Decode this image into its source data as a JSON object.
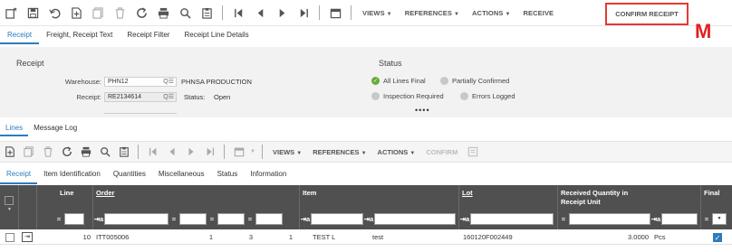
{
  "toolbar": {
    "views": "VIEWS",
    "references": "REFERENCES",
    "actions": "ACTIONS",
    "receive": "RECEIVE",
    "confirm_receipt": "CONFIRM RECEIPT",
    "icons": [
      "clear-icon",
      "save-icon",
      "undo-icon",
      "new-icon",
      "copy-icon",
      "delete-icon",
      "refresh-icon",
      "print-icon",
      "search-icon",
      "clipboard-icon",
      "first-icon",
      "prev-icon",
      "next-icon",
      "last-icon",
      "calendar-icon"
    ]
  },
  "annotation_letter": "M",
  "form_tabs": [
    "Receipt",
    "Freight, Receipt Text",
    "Receipt Filter",
    "Receipt Line Details"
  ],
  "receipt": {
    "title": "Receipt",
    "warehouse_label": "Warehouse:",
    "warehouse_value": "PHN12",
    "warehouse_desc": "PHNSA PRODUCTION",
    "receipt_label": "Receipt:",
    "receipt_value": "RE2134614",
    "status_label": "Status:",
    "status_value": "Open"
  },
  "status": {
    "title": "Status",
    "items": [
      {
        "label": "All Lines Final",
        "state": "ok"
      },
      {
        "label": "Partially Confirmed",
        "state": "off"
      },
      {
        "label": "Inspection Required",
        "state": "off"
      },
      {
        "label": "Errors Logged",
        "state": "off"
      }
    ],
    "more": "••••"
  },
  "sub_tabs": [
    "Lines",
    "Message Log"
  ],
  "lines_toolbar": {
    "views": "VIEWS",
    "references": "REFERENCES",
    "actions": "ACTIONS",
    "confirm": "CONFIRM"
  },
  "line_tabs": [
    "Receipt",
    "Item Identification",
    "Quantities",
    "Miscellaneous",
    "Status",
    "Information"
  ],
  "grid": {
    "headers": {
      "line": "Line",
      "order": "Order",
      "item": "Item",
      "lot": "Lot",
      "received_qty": "Received Quantity in Receipt Unit",
      "final": "Final"
    },
    "rows": [
      {
        "line": "10",
        "order": "ITT005006",
        "c1": "1",
        "c2": "3",
        "c3": "1",
        "item": "TEST L",
        "item_desc": "test",
        "lot": "160120F002449",
        "qty": "3.0000",
        "unit": "Pcs",
        "final": true
      }
    ]
  },
  "colors": {
    "accent": "#2e7bbf",
    "header_bg": "#505050",
    "highlight": "#e53935",
    "ok": "#6aab3c"
  }
}
